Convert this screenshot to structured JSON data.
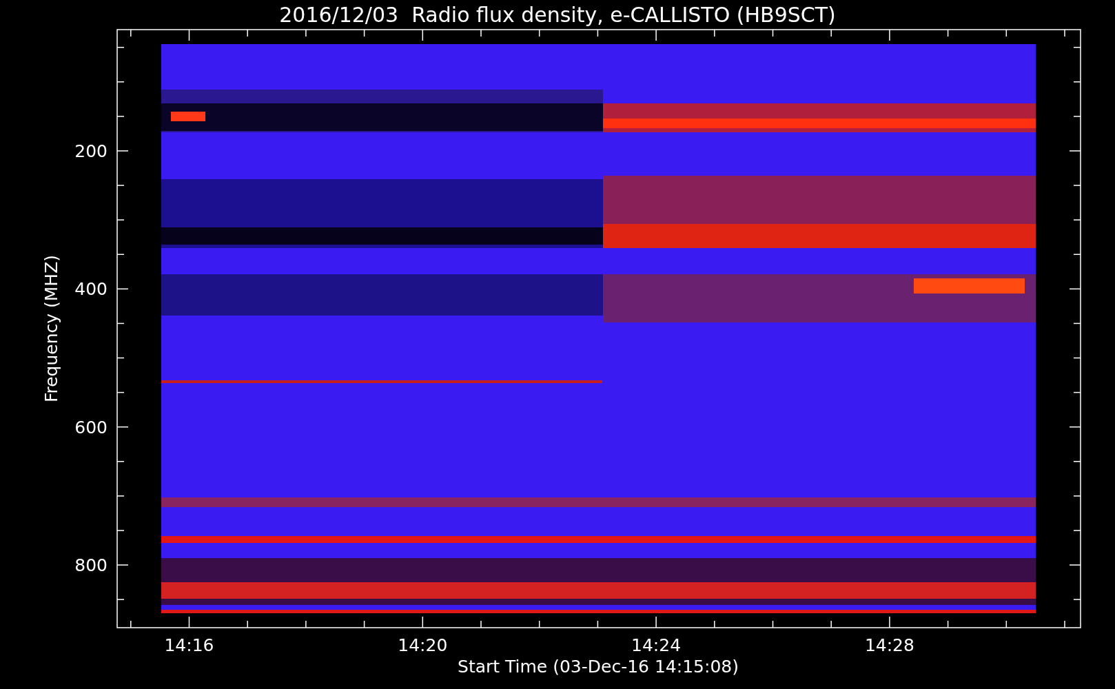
{
  "title": "2016/12/03  Radio flux density, e-CALLISTO (HB9SCT)",
  "y_axis": {
    "label": "Frequency (MHZ)",
    "ticks": [
      "200",
      "400",
      "600",
      "800"
    ]
  },
  "x_axis": {
    "label": "Start Time (03-Dec-16 14:15:08)",
    "ticks": [
      "14:16",
      "14:20",
      "14:24",
      "14:28"
    ]
  }
}
